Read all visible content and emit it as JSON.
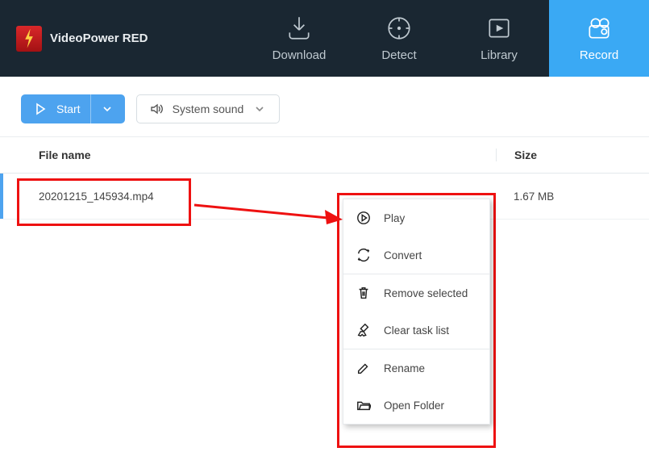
{
  "brand": {
    "title": "VideoPower RED"
  },
  "nav": {
    "download": "Download",
    "detect": "Detect",
    "library": "Library",
    "record": "Record"
  },
  "toolbar": {
    "start_label": "Start",
    "sound_label": "System sound"
  },
  "table": {
    "col_filename": "File name",
    "col_size": "Size",
    "rows": [
      {
        "name": "20201215_145934.mp4",
        "size": "1.67 MB"
      }
    ]
  },
  "context_menu": {
    "play": "Play",
    "convert": "Convert",
    "remove": "Remove selected",
    "clear": "Clear task list",
    "rename": "Rename",
    "open_folder": "Open Folder"
  }
}
